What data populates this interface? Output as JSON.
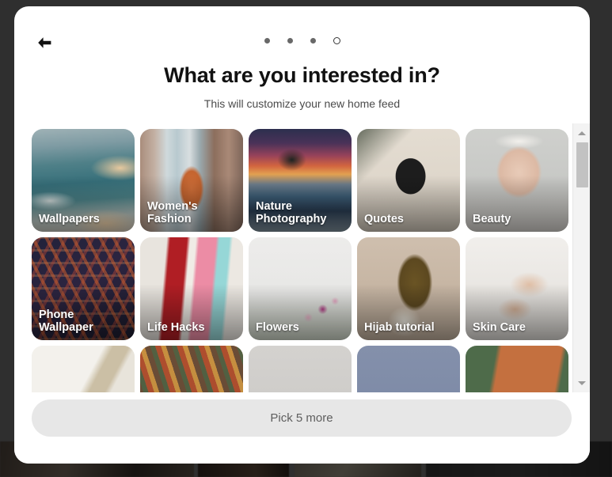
{
  "modal": {
    "back_button_icon": "arrow-left-icon",
    "title": "What are you interested in?",
    "subtitle": "This will customize your new home feed",
    "pagination": {
      "total_steps": 4,
      "current_step": 4,
      "dots": [
        {
          "state": "filled"
        },
        {
          "state": "filled"
        },
        {
          "state": "filled"
        },
        {
          "state": "hollow"
        }
      ]
    },
    "grid": {
      "columns": 5,
      "tiles": [
        {
          "label": "Wallpapers",
          "art": "art-wallpapers",
          "selected": false
        },
        {
          "label": "Women's Fashion",
          "art": "art-womens",
          "selected": false
        },
        {
          "label": "Nature Photography",
          "art": "art-nature",
          "selected": false
        },
        {
          "label": "Quotes",
          "art": "art-quotes",
          "selected": false
        },
        {
          "label": "Beauty",
          "art": "art-beauty",
          "selected": false
        },
        {
          "label": "Phone Wallpaper",
          "art": "art-phone",
          "selected": false
        },
        {
          "label": "Life Hacks",
          "art": "art-lifehacks",
          "selected": false
        },
        {
          "label": "Flowers",
          "art": "art-flowers",
          "selected": false
        },
        {
          "label": "Hijab tutorial",
          "art": "art-hijab",
          "selected": false
        },
        {
          "label": "Skin Care",
          "art": "art-skincare",
          "selected": false
        },
        {
          "label": "",
          "art": "art-journal",
          "selected": false
        },
        {
          "label": "",
          "art": "art-paint",
          "selected": false
        },
        {
          "label": "",
          "art": "art-coffee",
          "selected": false
        },
        {
          "label": "",
          "art": "art-blue",
          "selected": false
        },
        {
          "label": "",
          "art": "art-cartoon",
          "selected": false
        }
      ]
    },
    "scrollbar": {
      "up_arrow_icon": "triangle-up-icon",
      "down_arrow_icon": "triangle-down-icon"
    },
    "footer": {
      "primary_button_label": "Pick 5 more",
      "primary_button_enabled": false
    }
  },
  "colors": {
    "backdrop": "#2f2f2f",
    "modal_bg": "#ffffff",
    "title_text": "#111111",
    "subtitle_text": "#4b4b4b",
    "button_bg": "#e7e7e7",
    "button_text": "#5e5e5e",
    "dot_filled": "#686868",
    "dot_outline": "#353535",
    "tile_label": "#ffffff",
    "scrollbar_track": "#f3f3f3",
    "scrollbar_thumb": "#c2c2c2"
  }
}
